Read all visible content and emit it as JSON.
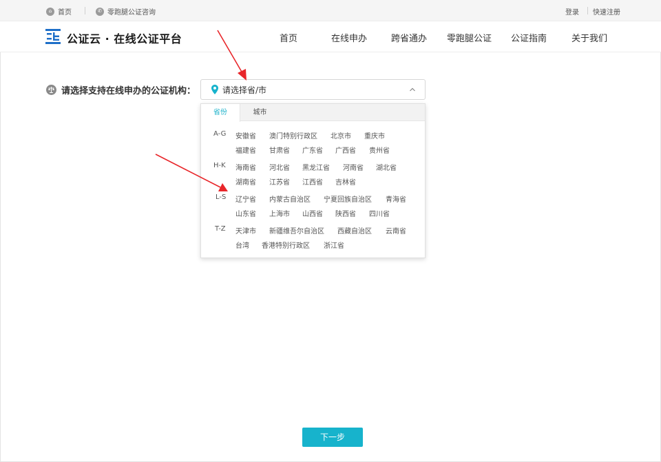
{
  "topbar": {
    "home_label": "首页",
    "consult_label": "零跑腿公证咨询",
    "login_label": "登录",
    "register_label": "快速注册"
  },
  "header": {
    "logo_text": "公证云 · 在线公证平台",
    "nav": [
      "首页",
      "在线申办",
      "跨省通办",
      "零跑腿公证",
      "公证指南",
      "关于我们"
    ]
  },
  "selector": {
    "label": "请选择支持在线申办的公证机构：",
    "placeholder": "请选择省/市"
  },
  "dropdown": {
    "tabs": [
      "省份",
      "城市"
    ],
    "active_tab": "省份",
    "groups": [
      {
        "label": "A-G",
        "rows": [
          [
            "安徽省",
            "澳门特别行政区",
            "北京市",
            "重庆市"
          ],
          [
            "福建省",
            "甘肃省",
            "广东省",
            "广西省",
            "贵州省"
          ]
        ]
      },
      {
        "label": "H-K",
        "rows": [
          [
            "海南省",
            "河北省",
            "黑龙江省",
            "河南省",
            "湖北省"
          ],
          [
            "湖南省",
            "江苏省",
            "江西省",
            "吉林省"
          ]
        ]
      },
      {
        "label": "L-S",
        "rows": [
          [
            "辽宁省",
            "内蒙古自治区",
            "宁夏回族自治区",
            "青海省"
          ],
          [
            "山东省",
            "上海市",
            "山西省",
            "陕西省",
            "四川省"
          ]
        ]
      },
      {
        "label": "T-Z",
        "rows": [
          [
            "天津市",
            "新疆维吾尔自治区",
            "西藏自治区",
            "云南省"
          ],
          [
            "台湾",
            "香港特别行政区",
            "浙江省"
          ]
        ]
      }
    ]
  },
  "actions": {
    "next_label": "下一步"
  },
  "colors": {
    "accent": "#17b3cc",
    "arrow": "#e8262a",
    "logo_blue": "#1e6fc8"
  }
}
